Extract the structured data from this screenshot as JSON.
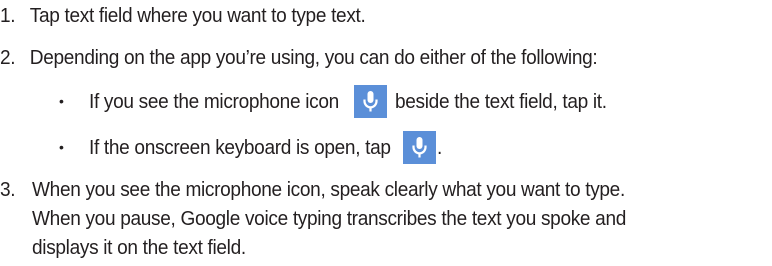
{
  "steps": [
    {
      "number": "1.",
      "text": "Tap text field where you want to type text."
    },
    {
      "number": "2.",
      "text": "Depending on the app you’re using, you can do either of the following:"
    },
    {
      "number": "3.",
      "lines": [
        "When you see the microphone icon, speak clearly what you want to type.",
        "When you pause, Google voice typing transcribes the text you spoke and",
        "displays it on the text field."
      ]
    }
  ],
  "bullets": [
    {
      "marker": "•",
      "before": "If you see the microphone icon",
      "after": "beside the text field, tap it."
    },
    {
      "marker": "•",
      "before": "If the onscreen keyboard is open, tap",
      "after": "."
    }
  ],
  "icons": {
    "mic": "microphone-icon",
    "mic_bg": "#5b8fd8",
    "mic_fg": "#ffffff"
  }
}
